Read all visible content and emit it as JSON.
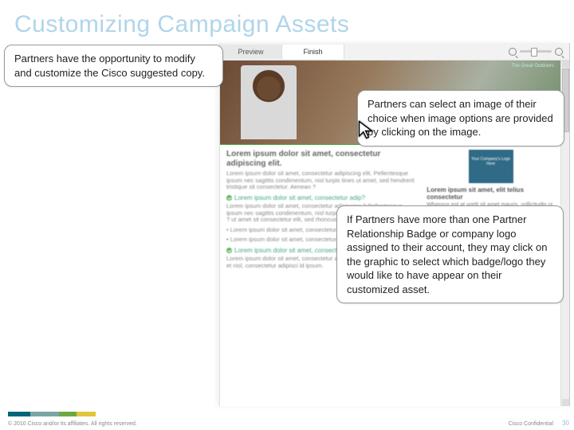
{
  "slide": {
    "title": "Customizing Campaign Assets",
    "page_number": "30",
    "copyright": "© 2010 Cisco and/or its affiliates. All rights reserved.",
    "confidential": "Cisco Confidential"
  },
  "callouts": {
    "intro": "Partners have the opportunity to modify and customize the Cisco suggested copy.",
    "image": "Partners can select an image of their choice when image options are provided by clicking on the image.",
    "badge": "If Partners have more than one Partner Relationship Badge or company logo assigned to their account, they may click on the graphic to select which badge/logo they would like to have appear on their customized asset."
  },
  "app": {
    "tabs": {
      "preview": "Preview",
      "finish": "Finish"
    },
    "hero_overline": "The Great Outdoors",
    "logo_placeholder": "Your Company's Logo Here",
    "body": {
      "heading": "Lorem ipsum dolor sit amet, consectetur adipiscing elit.",
      "para1": "Lorem ipsum dolor sit amet, consectetur adipiscing elit. Pellentesque ipsum nec sagittis condimentum, nisl turpis tines ut amet, sed hendrerit tristique sit consectetur. Aenean ?",
      "q1": "Lorem ipsum dolor sit amet, consectetur adip?",
      "para2": "Lorem ipsum dolor sit amet, consectetur adipiscing ? Pellentesque ipsum nec sagittis condimentum, nisl turpis. Blandit , amet, sed rhoncus ? ut amet sit consectetur elit, sed rhoncus tellus turpis sit amet, Aenean.",
      "bullet1": "Lorem ipsum dolor sit amet, consectetur adipiscing elit. Pel ?",
      "bullet2": "Lorem ipsum dolor sit amet, consectetur adipiscing elit. Pel ?",
      "q2": "Lorem ipsum dolor sit amet, consectetur adip?",
      "para3": "Lorem ipsum dolor sit amet, consectetur adipiscing elit. Pel lorem dolor et nisl, consectetur adipisci id ipsum.",
      "side_h": "Lorem ipsum sit amet, elit telius consectetur",
      "side_p": "Whassus est at vortit sit amet mauris, sollicitudin ni ?"
    }
  }
}
